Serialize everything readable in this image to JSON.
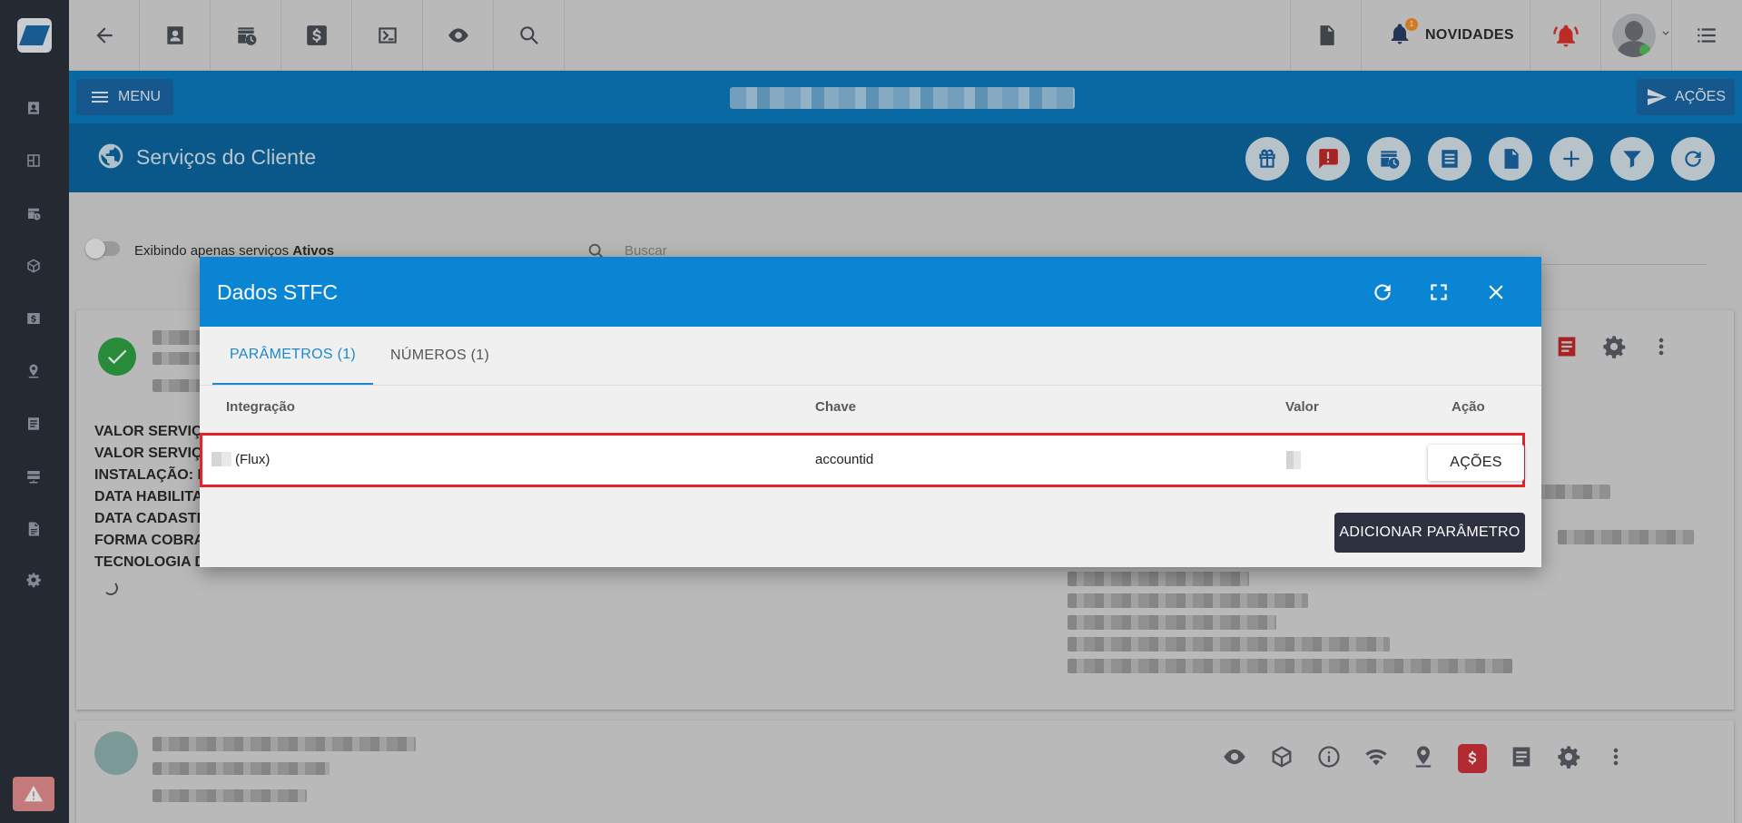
{
  "topbar": {
    "novidades_label": "NOVIDADES",
    "notification_count": "1"
  },
  "bluebar": {
    "menu_label": "MENU",
    "actions_label": "AÇÕES"
  },
  "page": {
    "title": "Serviços do Cliente"
  },
  "filter": {
    "toggle_label_prefix": "Exibindo apenas serviços ",
    "toggle_label_bold": "Ativos",
    "search_placeholder": "Buscar"
  },
  "service_card": {
    "info_lines": [
      "VALOR SERVIÇ",
      "VALOR SERVIÇ",
      "INSTALAÇÃO: F",
      "DATA HABILITA",
      "DATA CADASTR",
      "FORMA COBRA",
      "TECNOLOGIA D"
    ]
  },
  "modal": {
    "title": "Dados STFC",
    "tabs": [
      {
        "label": "PARÂMETROS (1)",
        "active": true
      },
      {
        "label": "NÚMEROS (1)",
        "active": false
      }
    ],
    "columns": {
      "integracao": "Integração",
      "chave": "Chave",
      "valor": "Valor",
      "acao": "Ação"
    },
    "rows": [
      {
        "integracao": "(Flux)",
        "chave": "accountid",
        "valor": "",
        "action_label": "AÇÕES"
      }
    ],
    "add_button_label": "ADICIONAR PARÂMETRO"
  },
  "colors": {
    "primary_blue": "#0b79bd",
    "modal_header": "#0a85d4",
    "highlight_border": "#e3222a",
    "success": "#2ea244",
    "danger": "#d9342b"
  }
}
